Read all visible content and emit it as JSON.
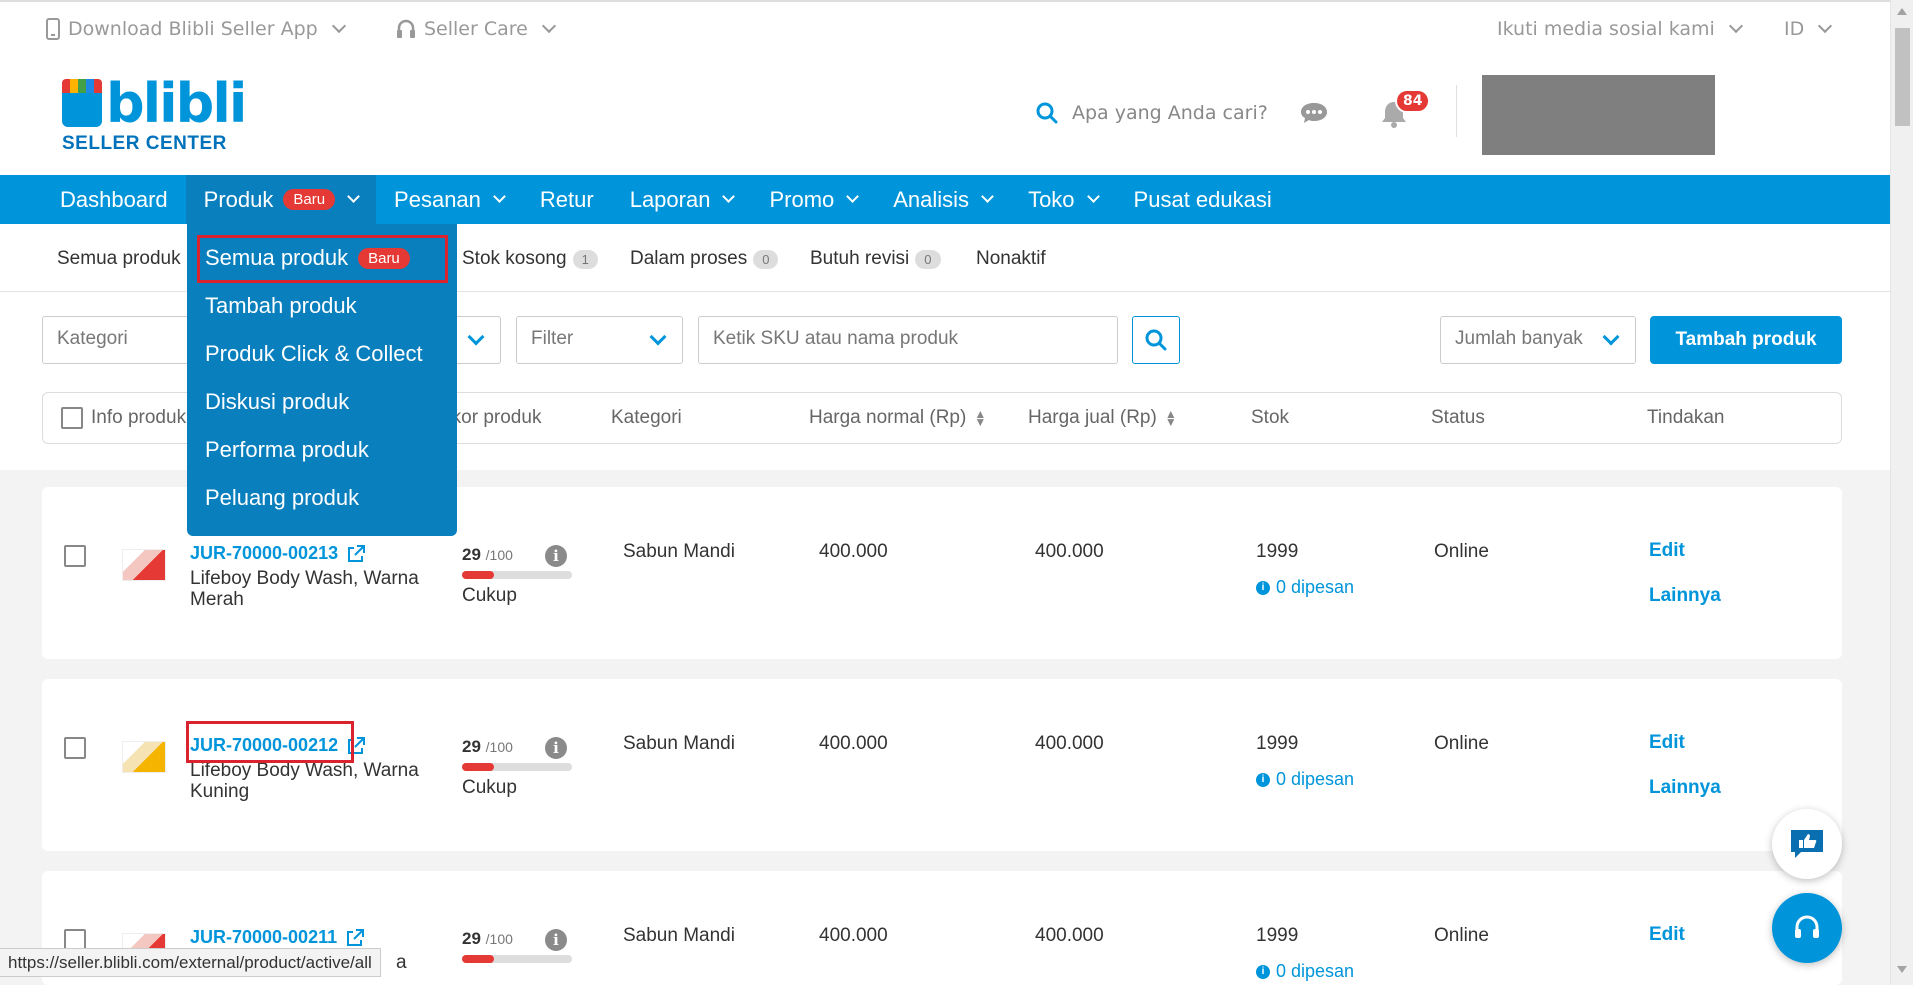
{
  "topbar": {
    "download_app": "Download Blibli Seller App",
    "seller_care": "Seller Care",
    "social": "Ikuti media sosial kami",
    "language": "ID"
  },
  "header": {
    "logo_word": "blibli",
    "logo_sub": "SELLER CENTER",
    "search_placeholder": "Apa yang Anda cari?",
    "notification_count": "84"
  },
  "nav": {
    "items": [
      {
        "label": "Dashboard"
      },
      {
        "label": "Produk",
        "badge": "Baru"
      },
      {
        "label": "Pesanan"
      },
      {
        "label": "Retur"
      },
      {
        "label": "Laporan"
      },
      {
        "label": "Promo"
      },
      {
        "label": "Analisis"
      },
      {
        "label": "Toko"
      },
      {
        "label": "Pusat edukasi"
      }
    ]
  },
  "dropdown": {
    "items": [
      {
        "label": "Semua produk",
        "badge": "Baru"
      },
      {
        "label": "Tambah produk"
      },
      {
        "label": "Produk Click & Collect"
      },
      {
        "label": "Diskusi produk"
      },
      {
        "label": "Performa produk"
      },
      {
        "label": "Peluang produk"
      }
    ]
  },
  "subtabs": {
    "all": "Semua produk",
    "empty_stock": "Stok kosong",
    "empty_stock_count": "1",
    "in_process": "Dalam proses",
    "in_process_count": "0",
    "needs_revision": "Butuh revisi",
    "needs_revision_count": "0",
    "inactive": "Nonaktif"
  },
  "toolbar": {
    "category_placeholder": "Kategori",
    "filter_label": "Filter",
    "search_placeholder": "Ketik SKU atau nama produk",
    "sort_label": "Jumlah banyak",
    "add_product": "Tambah produk"
  },
  "table": {
    "headers": {
      "info": "Info produk",
      "score": "Skor produk",
      "category": "Kategori",
      "normal_price": "Harga normal (Rp)",
      "sale_price": "Harga jual (Rp)",
      "stock": "Stok",
      "status": "Status",
      "actions": "Tindakan"
    },
    "rows": [
      {
        "sku": "JUR-70000-00213",
        "name": "Lifeboy Body Wash, Warna Merah",
        "score": "29",
        "score_max": "/100",
        "score_label": "Cukup",
        "category": "Sabun Mandi",
        "normal_price": "400.000",
        "sale_price": "400.000",
        "stock": "1999",
        "reserved": "0 dipesan",
        "status": "Online",
        "edit": "Edit",
        "more": "Lainnya"
      },
      {
        "sku": "JUR-70000-00212",
        "name": "Lifeboy Body Wash, Warna Kuning",
        "score": "29",
        "score_max": "/100",
        "score_label": "Cukup",
        "category": "Sabun Mandi",
        "normal_price": "400.000",
        "sale_price": "400.000",
        "stock": "1999",
        "reserved": "0 dipesan",
        "status": "Online",
        "edit": "Edit",
        "more": "Lainnya"
      },
      {
        "sku": "JUR-70000-00211",
        "name": "a",
        "score": "29",
        "score_max": "/100",
        "category": "Sabun Mandi",
        "normal_price": "400.000",
        "sale_price": "400.000",
        "stock": "1999",
        "reserved": "0 dipesan",
        "status": "Online",
        "edit": "Edit"
      }
    ]
  },
  "statusbar": {
    "url": "https://seller.blibli.com/external/product/active/all"
  },
  "colors": {
    "brand": "#0095da",
    "danger": "#e53935",
    "highlight": "#d9232e"
  }
}
